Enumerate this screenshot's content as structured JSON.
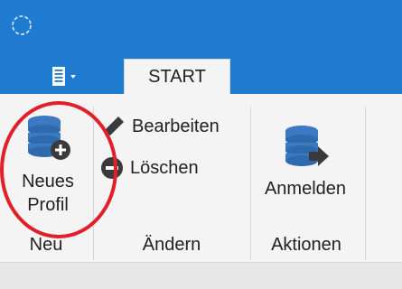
{
  "tabs": [
    {
      "label": "START"
    }
  ],
  "groups": {
    "neu": {
      "label": "Neu",
      "new_profile": {
        "line1": "Neues",
        "line2": "Profil",
        "icon": "database-add-icon"
      }
    },
    "aendern": {
      "label": "Ändern",
      "edit": {
        "label": "Bearbeiten",
        "icon": "pencil-icon"
      },
      "delete": {
        "label": "Löschen",
        "icon": "minus-circle-icon"
      }
    },
    "aktionen": {
      "label": "Aktionen",
      "login": {
        "label": "Anmelden",
        "icon": "database-arrow-icon"
      }
    }
  },
  "colors": {
    "titlebar": "#1e7bd0",
    "ribbon": "#f4f4f4",
    "icon_blue": "#3b79c2",
    "icon_dark": "#3a3a3a",
    "highlight": "#e0202a"
  }
}
